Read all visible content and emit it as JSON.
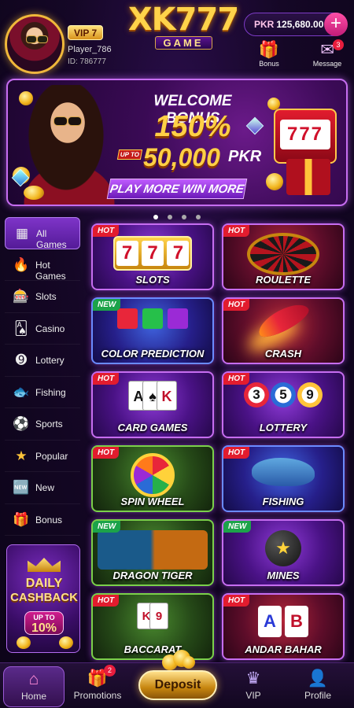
{
  "header": {
    "vip_level": "VIP 7",
    "player_name": "Player_786",
    "player_id": "ID: 786777",
    "logo_main": "XK777",
    "logo_sub": "GAME",
    "balance_currency": "PKR",
    "balance_amount": "125,680.00",
    "add_label": "+",
    "bonus_label": "Bonus",
    "message_label": "Message",
    "message_count": "3"
  },
  "banner": {
    "title": "WELCOME BONUS",
    "percent": "150%",
    "upto": "UP TO",
    "amount": "50,000",
    "currency": "PKR",
    "cta": "PLAY MORE WIN MORE",
    "slot_reels": "777"
  },
  "sidebar": {
    "items": [
      {
        "label": "All Games",
        "icon": "grid-icon",
        "glyph": "▦"
      },
      {
        "label": "Hot Games",
        "icon": "fire-icon",
        "glyph": "🔥"
      },
      {
        "label": "Slots",
        "icon": "slot-machine-icon",
        "glyph": "🎰"
      },
      {
        "label": "Casino",
        "icon": "cards-icon",
        "glyph": "🂡"
      },
      {
        "label": "Lottery",
        "icon": "lottery-ball-icon",
        "glyph": "➒"
      },
      {
        "label": "Fishing",
        "icon": "fish-icon",
        "glyph": "🐟"
      },
      {
        "label": "Sports",
        "icon": "soccer-ball-icon",
        "glyph": "⚽"
      },
      {
        "label": "Popular",
        "icon": "star-icon",
        "glyph": "★"
      },
      {
        "label": "New",
        "icon": "new-badge-icon",
        "glyph": "🆕"
      },
      {
        "label": "Bonus",
        "icon": "gift-icon",
        "glyph": "🎁"
      }
    ]
  },
  "cashback": {
    "line1": "DAILY",
    "line2": "CASHBACK",
    "upto": "UP TO",
    "percent": "10%"
  },
  "games": [
    {
      "tag": "HOT",
      "label": "SLOTS"
    },
    {
      "tag": "HOT",
      "label": "ROULETTE"
    },
    {
      "tag": "NEW",
      "label": "COLOR PREDICTION"
    },
    {
      "tag": "HOT",
      "label": "CRASH"
    },
    {
      "tag": "HOT",
      "label": "CARD GAMES"
    },
    {
      "tag": "HOT",
      "label": "LOTTERY"
    },
    {
      "tag": "HOT",
      "label": "SPIN WHEEL"
    },
    {
      "tag": "HOT",
      "label": "FISHING"
    },
    {
      "tag": "NEW",
      "label": "DRAGON TIGER"
    },
    {
      "tag": "NEW",
      "label": "MINES"
    },
    {
      "tag": "HOT",
      "label": "BACCARAT"
    },
    {
      "tag": "HOT",
      "label": "ANDAR BAHAR"
    }
  ],
  "art": {
    "seven": "7",
    "lottery_balls": [
      "3",
      "5",
      "9"
    ],
    "card_ace": "A",
    "card_spade": "♠",
    "card_k": "K",
    "card_9": "9",
    "card_a_red": "A",
    "card_b": "B",
    "mine_star": "★"
  },
  "bottom_nav": {
    "home": "Home",
    "promotions": "Promotions",
    "promotions_count": "2",
    "deposit": "Deposit",
    "vip": "VIP",
    "profile": "Profile"
  },
  "colors": {
    "accent_purple": "#7e34c8",
    "gold": "#ffd046",
    "hot_red": "#e21c2e",
    "new_green": "#1ca34a",
    "pink": "#ff4fa7"
  }
}
